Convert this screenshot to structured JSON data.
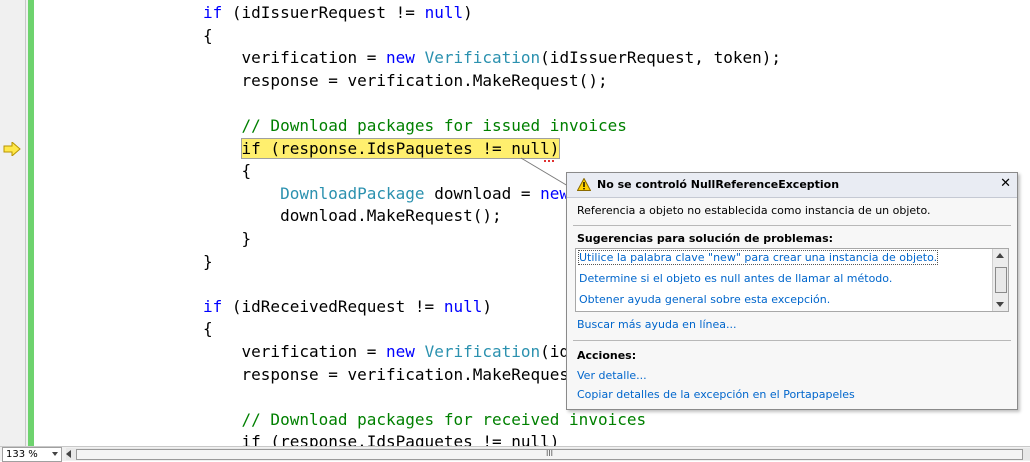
{
  "code_lines": [
    {
      "tokens": [
        {
          "t": "if",
          "c": "kw"
        },
        {
          "t": " (idIssuerRequest != "
        },
        {
          "t": "null",
          "c": "kw"
        },
        {
          "t": ")"
        }
      ]
    },
    {
      "tokens": [
        {
          "t": "{"
        }
      ]
    },
    {
      "tokens": [
        {
          "t": "    verification = "
        },
        {
          "t": "new",
          "c": "kw"
        },
        {
          "t": " "
        },
        {
          "t": "Verification",
          "c": "ty"
        },
        {
          "t": "(idIssuerRequest, token);"
        }
      ]
    },
    {
      "tokens": [
        {
          "t": "    response = verification.MakeRequest();"
        }
      ]
    },
    {
      "tokens": []
    },
    {
      "tokens": [
        {
          "t": "    // Download packages for issued invoices",
          "c": "cm"
        }
      ]
    },
    {
      "tokens": [
        {
          "t": "    if (response.IdsPaquetes != null)",
          "c": "hl"
        }
      ]
    },
    {
      "tokens": [
        {
          "t": "    {"
        }
      ]
    },
    {
      "tokens": [
        {
          "t": "        "
        },
        {
          "t": "DownloadPackage",
          "c": "ty"
        },
        {
          "t": " download = "
        },
        {
          "t": "new",
          "c": "kw"
        }
      ]
    },
    {
      "tokens": [
        {
          "t": "        download.MakeRequest();"
        }
      ]
    },
    {
      "tokens": [
        {
          "t": "    }"
        }
      ]
    },
    {
      "tokens": [
        {
          "t": "}"
        }
      ]
    },
    {
      "tokens": []
    },
    {
      "tokens": [
        {
          "t": "if",
          "c": "kw"
        },
        {
          "t": " (idReceivedRequest != "
        },
        {
          "t": "null",
          "c": "kw"
        },
        {
          "t": ")"
        }
      ]
    },
    {
      "tokens": [
        {
          "t": "{"
        }
      ]
    },
    {
      "tokens": [
        {
          "t": "    verification = "
        },
        {
          "t": "new",
          "c": "kw"
        },
        {
          "t": " "
        },
        {
          "t": "Verification",
          "c": "ty"
        },
        {
          "t": "(id"
        }
      ]
    },
    {
      "tokens": [
        {
          "t": "    response = verification.MakeRequest"
        }
      ]
    },
    {
      "tokens": []
    },
    {
      "tokens": [
        {
          "t": "    // Download packages for received invoices",
          "c": "cm"
        }
      ]
    },
    {
      "tokens": [
        {
          "t": "    if (response.IdsPaquetes != null)"
        }
      ]
    }
  ],
  "exception_popup": {
    "title": "No se controló NullReferenceException",
    "message": "Referencia a objeto no establecida como instancia de un objeto.",
    "suggestions_title": "Sugerencias para solución de problemas:",
    "suggestions": [
      "Utilice la palabra clave \"new\" para crear una instancia de objeto.",
      "Determine si el objeto es null antes de llamar al método.",
      "Obtener ayuda general sobre esta excepción."
    ],
    "more_help_link": "Buscar más ayuda en línea...",
    "actions_title": "Acciones:",
    "actions": [
      "Ver detalle...",
      "Copiar detalles de la excepción en el Portapapeles"
    ],
    "close_glyph": "✕"
  },
  "status_bar": {
    "zoom_level": "133 %",
    "scroll_grip": "III"
  },
  "colors": {
    "keyword": "#0000ff",
    "type": "#2b91af",
    "comment": "#008000",
    "current_statement_highlight": "#ffef6e",
    "change_bar": "#6ed36e",
    "link": "#0066cc"
  },
  "icons": {
    "current_line": "yellow-arrow-icon",
    "popup_warning": "warning-triangle-icon"
  }
}
